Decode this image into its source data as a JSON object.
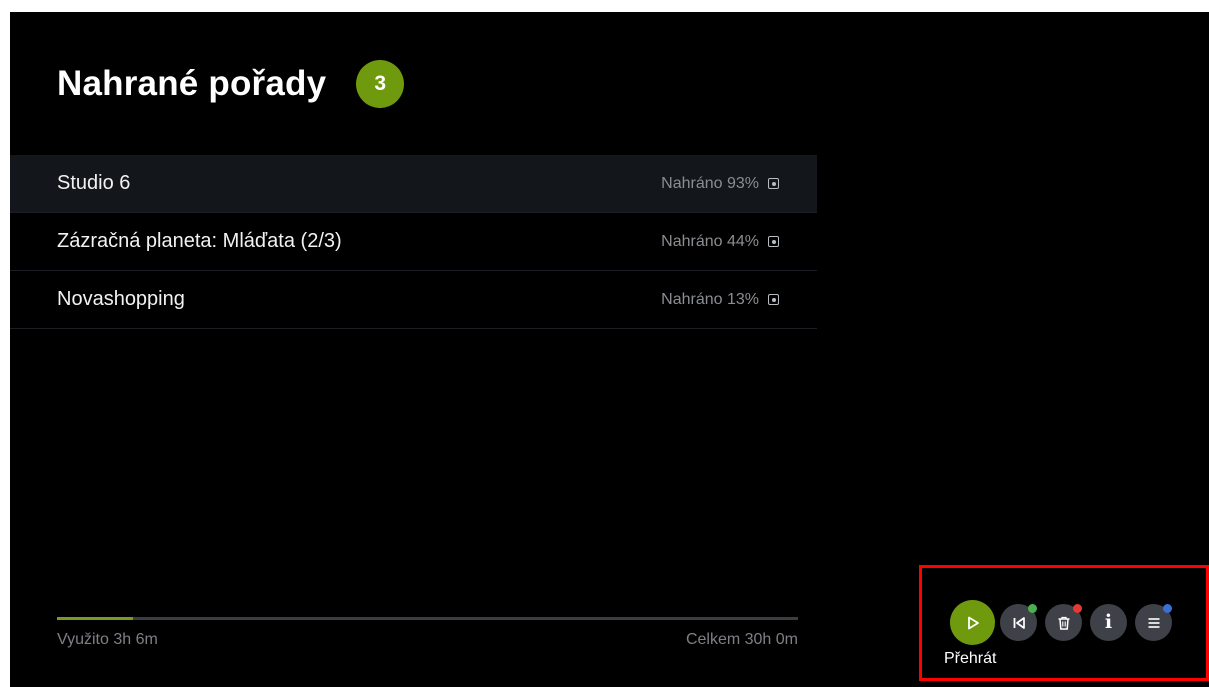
{
  "header": {
    "title": "Nahrané pořady",
    "count": "3"
  },
  "recordings": [
    {
      "title": "Studio 6",
      "status": "Nahráno 93%",
      "selected": true
    },
    {
      "title": "Zázračná planeta: Mláďata (2/3)",
      "status": "Nahráno 44%",
      "selected": false
    },
    {
      "title": "Novashopping",
      "status": "Nahráno 13%",
      "selected": false
    }
  ],
  "storage": {
    "used_label": "Využito 3h 6m",
    "total_label": "Celkem 30h 0m",
    "used_fraction": 0.103
  },
  "controls": {
    "buttons": [
      {
        "name": "play",
        "icon": "play-icon"
      },
      {
        "name": "restart",
        "icon": "skip-back-icon",
        "dot_color": "#4caf50"
      },
      {
        "name": "delete",
        "icon": "trash-icon",
        "dot_color": "#e53935"
      },
      {
        "name": "info",
        "icon": "info-icon"
      },
      {
        "name": "menu",
        "icon": "menu-icon",
        "dot_color": "#3b6fd6"
      }
    ],
    "focused_label": "Přehrát"
  },
  "colors": {
    "accent": "#6f9a0e",
    "annotation_box": "#ff0000"
  }
}
